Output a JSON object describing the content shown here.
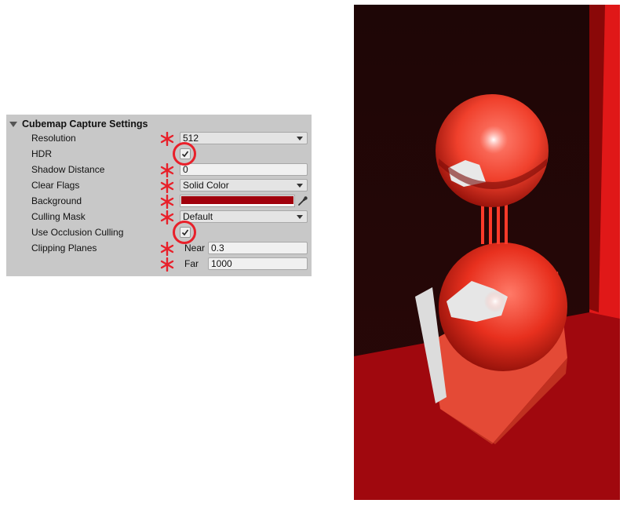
{
  "panel": {
    "title": "Cubemap Capture Settings",
    "rows": {
      "resolution": {
        "label": "Resolution",
        "value": "512"
      },
      "hdr": {
        "label": "HDR",
        "checked": true
      },
      "shadow_distance": {
        "label": "Shadow Distance",
        "value": "0"
      },
      "clear_flags": {
        "label": "Clear Flags",
        "value": "Solid Color"
      },
      "background": {
        "label": "Background",
        "color": "#a0000c"
      },
      "culling_mask": {
        "label": "Culling Mask",
        "value": "Default"
      },
      "use_occlusion_culling": {
        "label": "Use Occlusion Culling",
        "checked": true
      },
      "clipping_planes": {
        "label": "Clipping Planes",
        "near_label": "Near",
        "near_value": "0.3",
        "far_label": "Far",
        "far_value": "1000"
      }
    }
  },
  "annotation_color": "#e8202a",
  "icons": [
    "foldout-arrow-icon",
    "dropdown-arrow-icon",
    "checkmark-icon",
    "eyedropper-icon",
    "asterisk-icon"
  ]
}
